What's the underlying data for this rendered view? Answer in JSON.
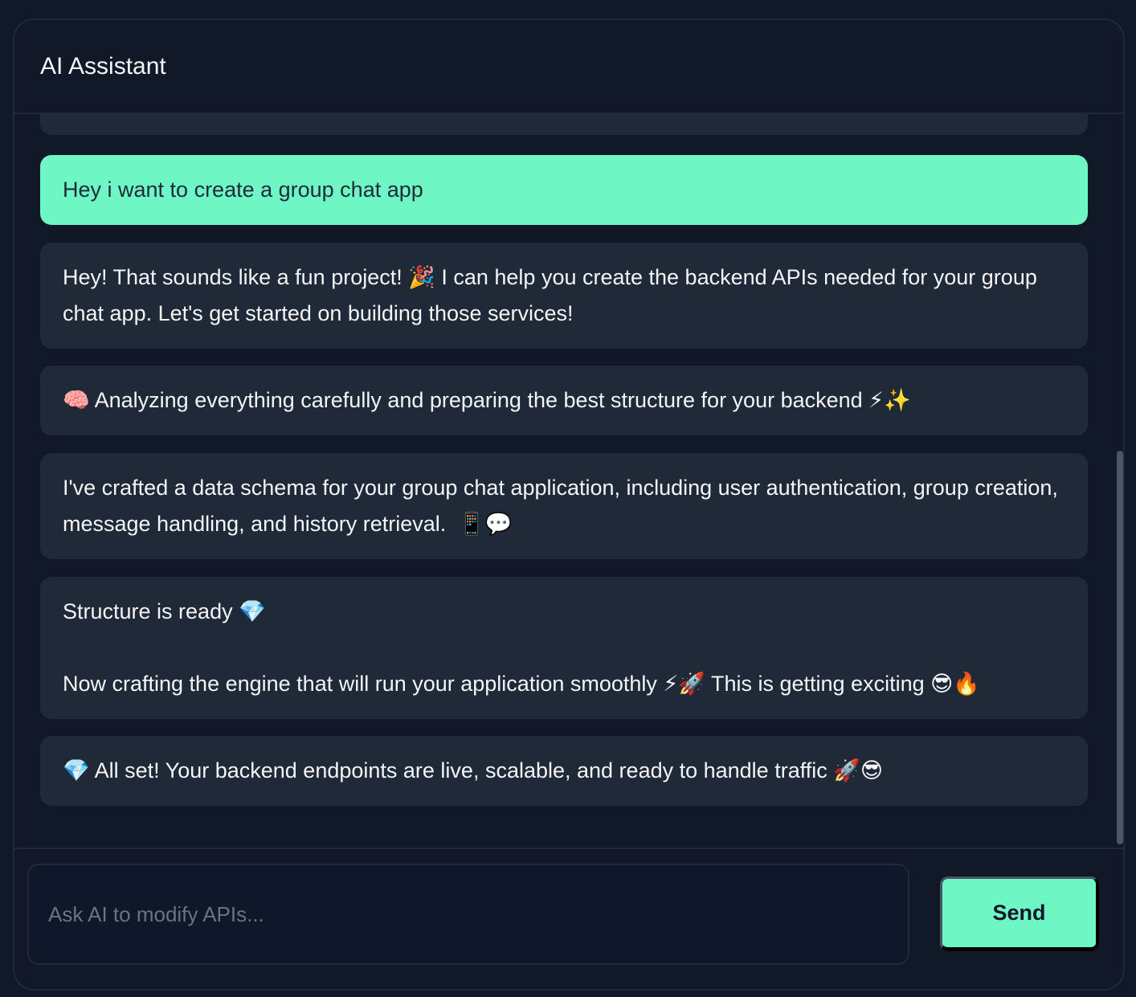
{
  "header": {
    "title": "AI Assistant"
  },
  "messages": [
    {
      "role": "user",
      "text": "Hey i want to create a group chat app"
    },
    {
      "role": "assistant",
      "text": "Hey! That sounds like a fun project! 🎉 I can help you create the backend APIs needed for your group chat app. Let's get started on building those services!"
    },
    {
      "role": "assistant",
      "text": "🧠 Analyzing everything carefully and preparing the best structure for your backend ⚡✨"
    },
    {
      "role": "assistant",
      "text": "I've crafted a data schema for your group chat application, including user authentication, group creation, message handling, and history retrieval.  📱💬"
    },
    {
      "role": "assistant",
      "text": "Structure is ready 💎\n\nNow crafting the engine that will run your application smoothly ⚡🚀 This is getting exciting 😎🔥"
    },
    {
      "role": "assistant",
      "text": "💎 All set! Your backend endpoints are live, scalable, and ready to handle traffic 🚀😎"
    }
  ],
  "composer": {
    "placeholder": "Ask AI to modify APIs...",
    "value": "",
    "send_label": "Send"
  },
  "colors": {
    "background": "#111827",
    "bubble": "#1f2937",
    "accent": "#6ef7c4",
    "text": "#f3f4f6"
  }
}
